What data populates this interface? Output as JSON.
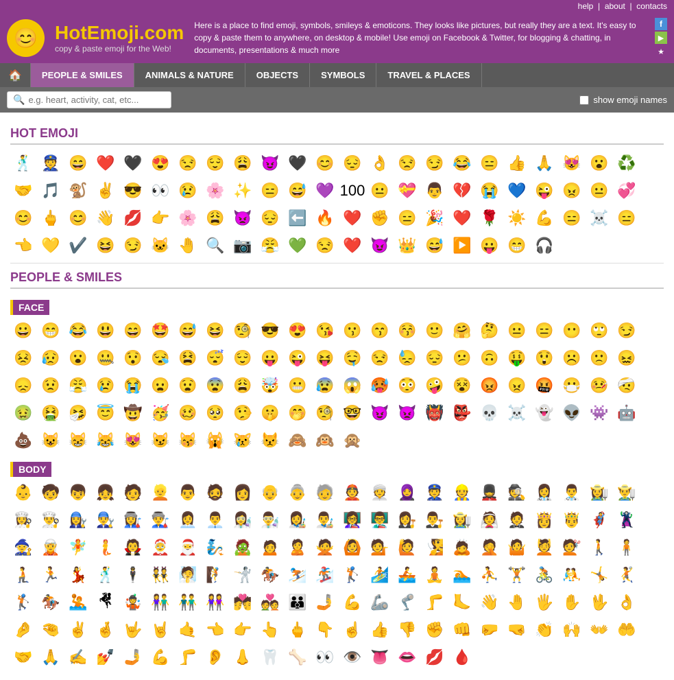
{
  "topnav": {
    "help": "help",
    "about": "about",
    "contacts": "contacts"
  },
  "header": {
    "logo_emoji": "😊",
    "site_title": "HotEmoji.com",
    "site_subtitle": "copy & paste emoji for the Web!",
    "description": "Here is a place to find emoji, symbols, smileys & emoticons. They looks like pictures, but really they are a text. It's easy to copy & paste them to anywhere, on desktop & mobile! Use emoji on Facebook & Twitter, for blogging & chatting, in documents, presentations & much more"
  },
  "catnav": {
    "home_label": "🏠",
    "items": [
      {
        "label": "PEOPLE & SMILES",
        "active": true
      },
      {
        "label": "ANIMALS & NATURE",
        "active": false
      },
      {
        "label": "OBJECTS",
        "active": false
      },
      {
        "label": "SYMBOLS",
        "active": false
      },
      {
        "label": "TRAVEL & PLACES",
        "active": false
      }
    ]
  },
  "search": {
    "placeholder": "e.g. heart, activity, cat, etc...",
    "show_names_label": "show emoji names"
  },
  "hot_emoji": {
    "title": "HOT EMOJI",
    "emojis": [
      "🕺",
      "👮",
      "😄",
      "❤️",
      "🖤",
      "😍",
      "😒",
      "😌",
      "😩",
      "😈",
      "🖤",
      "😊",
      "😔",
      "👌",
      "😒",
      "😏",
      "😂",
      "😑",
      "👍",
      "🙏",
      "😻",
      "😮",
      "♻️",
      "🤝",
      "🎵",
      "🐒",
      "✌️",
      "😎",
      "👀",
      "😢",
      "🌸",
      "✨",
      "😑",
      "😅",
      "💜",
      "100",
      "😐",
      "💝",
      "👨",
      "💔",
      "😭",
      "💙",
      "😜",
      "😠",
      "😐",
      "💞",
      "😊",
      "🖕",
      "😊",
      "👋",
      "💋",
      "👉",
      "🌸",
      "😩",
      "👿",
      "😔",
      "⬅️",
      "🔥",
      "❤️",
      "✊",
      "😑",
      "🎉",
      "❤️",
      "🌹",
      "☀️",
      "💪",
      "😑",
      "☠️",
      "😑",
      "👈",
      "💛",
      "✔️",
      "😆",
      "😏",
      "🐱",
      "🤚",
      "🔍",
      "📷",
      "😤",
      "💚",
      "😒",
      "❤️",
      "😈",
      "👑",
      "😅",
      "▶️",
      "😛",
      "😁",
      "🎧"
    ]
  },
  "people_smiles": {
    "title": "PEOPLE & SMILES",
    "face": {
      "label": "FACE",
      "emojis": [
        "😀",
        "😁",
        "😂",
        "😃",
        "😄",
        "🤩",
        "😅",
        "😆",
        "🧐",
        "😎",
        "😍",
        "😘",
        "😗",
        "😙",
        "😚",
        "🙂",
        "🤗",
        "🤔",
        "😐",
        "😑",
        "😶",
        "🙄",
        "😏",
        "😣",
        "😥",
        "😮",
        "🤐",
        "😯",
        "😪",
        "😫",
        "😴",
        "😌",
        "😛",
        "😜",
        "😝",
        "🤤",
        "😒",
        "😓",
        "😔",
        "😕",
        "🙃",
        "🤑",
        "😲",
        "☹️",
        "🙁",
        "😖",
        "😞",
        "😟",
        "😤",
        "😢",
        "😭",
        "😦",
        "😧",
        "😨",
        "😩",
        "🤯",
        "😬",
        "😰",
        "😱",
        "🥵",
        "😳",
        "🤪",
        "😵",
        "😡",
        "😠",
        "🤬",
        "😷",
        "🤒",
        "🤕",
        "🤢",
        "🤮",
        "🤧",
        "😇",
        "🤠",
        "🥳",
        "🥴",
        "🥺",
        "🤥",
        "🤫",
        "🤭",
        "🧐",
        "🤓",
        "😈",
        "👿",
        "👹",
        "👺",
        "💀",
        "☠️",
        "👻",
        "👽",
        "👾",
        "🤖",
        "💩",
        "😺",
        "😸",
        "😹",
        "😻",
        "😼",
        "😽",
        "🙀",
        "😿",
        "😾",
        "🙈",
        "🙉",
        "🙊"
      ]
    },
    "body": {
      "label": "BODY",
      "emojis": [
        "👶",
        "🧒",
        "👦",
        "👧",
        "🧑",
        "👱",
        "👨",
        "🧔",
        "👩",
        "👴",
        "👵",
        "🧓",
        "👲",
        "👳",
        "🧕",
        "👮",
        "👷",
        "💂",
        "🕵️",
        "👩‍⚕️",
        "👨‍⚕️",
        "👩‍🌾",
        "👨‍🌾",
        "👩‍🍳",
        "👨‍🍳",
        "👩‍🔧",
        "👨‍🔧",
        "👩‍🏭",
        "👨‍🏭",
        "👩‍💼",
        "👨‍💼",
        "👩‍🔬",
        "👨‍🔬",
        "👩‍🎨",
        "👨‍🎨",
        "👩‍🏫",
        "👨‍🏫",
        "👩‍⚖️",
        "👨‍⚖️",
        "👩‍🌾",
        "👰",
        "🤵",
        "👸",
        "🤴",
        "🦸",
        "🦹",
        "🧙",
        "🧝",
        "🧚",
        "🧜",
        "🧛",
        "🤶",
        "🎅",
        "🧞",
        "🧟",
        "🙍",
        "🙎",
        "🙅",
        "🙆",
        "💁",
        "🙋",
        "🧏",
        "🙇",
        "🤦",
        "🤷",
        "💆",
        "💇",
        "🚶",
        "🧍",
        "🧎",
        "🏃",
        "💃",
        "🕺",
        "🕴️",
        "👯",
        "🧖",
        "🧗",
        "🤺",
        "🏇",
        "⛷️",
        "🏂",
        "🏌️",
        "🏄",
        "🚣",
        "🧘",
        "🏊",
        "⛹️",
        "🏋️",
        "🚴",
        "🤼",
        "🤸",
        "🤾",
        "🏌️",
        "🏇",
        "🤽",
        "🤻",
        "🤹",
        "👫",
        "👬",
        "👭",
        "💏",
        "💑",
        "👪",
        "🤳",
        "💪",
        "🦾",
        "🦿",
        "🦵",
        "🦶",
        "👋",
        "🤚",
        "🖐️",
        "✋",
        "🖖",
        "👌",
        "🤌",
        "🤏",
        "✌️",
        "🤞",
        "🤟",
        "🤘",
        "🤙",
        "👈",
        "👉",
        "👆",
        "🖕",
        "👇",
        "☝️",
        "👍",
        "👎",
        "✊",
        "👊",
        "🤛",
        "🤜",
        "👏",
        "🙌",
        "👐",
        "🤲",
        "🤝",
        "🙏",
        "✍️",
        "💅",
        "🤳",
        "💪",
        "🦵",
        "👂",
        "👃",
        "🦷",
        "🦴",
        "👀",
        "👁️",
        "👅",
        "👄",
        "💋",
        "🩸"
      ]
    }
  }
}
